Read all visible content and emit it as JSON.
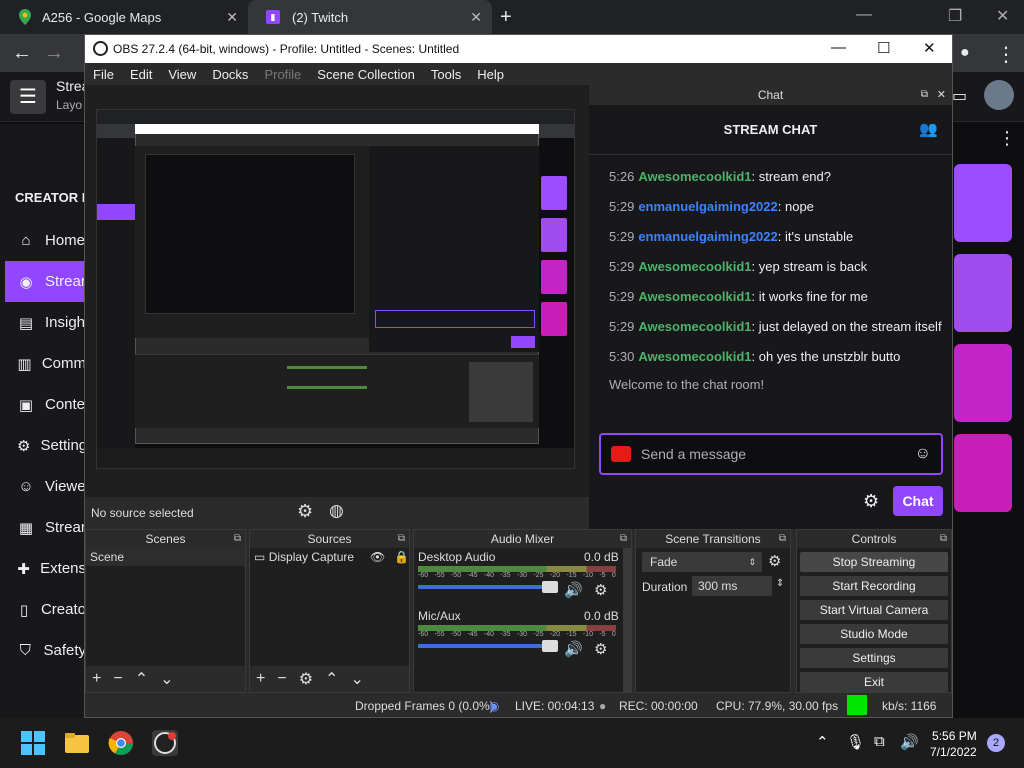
{
  "browser": {
    "tabs": [
      {
        "label": "A256 - Google Maps",
        "icon": "google-maps-icon"
      },
      {
        "label": "(2) Twitch",
        "icon": "twitch-icon"
      }
    ],
    "new_tab": "+"
  },
  "twitch": {
    "header_title": "Strea",
    "header_subtitle": "Layo",
    "creator_dashboard": "CREATOR D",
    "nav": [
      {
        "label": "Home",
        "icon": "home-icon"
      },
      {
        "label": "Strear",
        "icon": "stream-icon"
      },
      {
        "label": "Insigh",
        "icon": "insights-icon"
      },
      {
        "label": "Comm",
        "icon": "community-icon"
      },
      {
        "label": "Conte",
        "icon": "content-icon"
      },
      {
        "label": "Setting",
        "icon": "settings-icon"
      },
      {
        "label": "Viewe",
        "icon": "viewer-icon"
      },
      {
        "label": "Strear",
        "icon": "stream-tools-icon"
      },
      {
        "label": "Extens",
        "icon": "extensions-icon"
      },
      {
        "label": "Creato",
        "icon": "creator-camp-icon"
      },
      {
        "label": "Safety",
        "icon": "safety-icon"
      }
    ],
    "accent": "#9147ff"
  },
  "obs": {
    "title": "OBS 27.2.4 (64-bit, windows) - Profile: Untitled - Scenes: Untitled",
    "menu": [
      "File",
      "Edit",
      "View",
      "Docks",
      "Profile",
      "Scene Collection",
      "Tools",
      "Help"
    ],
    "source_status": "No source selected",
    "chat": {
      "dock_title": "Chat",
      "header": "STREAM CHAT",
      "messages": [
        {
          "time": "5:26",
          "user": "Awesomecoolkid1",
          "text": ": stream end?",
          "color": "#4bb36b"
        },
        {
          "time": "5:29",
          "user": "enmanuelgaiming2022",
          "text": ": nope",
          "color": "#3a83ff"
        },
        {
          "time": "5:29",
          "user": "enmanuelgaiming2022",
          "text": ": it's unstable",
          "color": "#3a83ff"
        },
        {
          "time": "5:29",
          "user": "Awesomecoolkid1",
          "text": ": yep stream is back",
          "color": "#4bb36b"
        },
        {
          "time": "5:29",
          "user": "Awesomecoolkid1",
          "text": ": it works fine for me",
          "color": "#4bb36b"
        },
        {
          "time": "5:29",
          "user": "Awesomecoolkid1",
          "text": ": just delayed on the stream itself",
          "color": "#4bb36b"
        },
        {
          "time": "5:30",
          "user": "Awesomecoolkid1",
          "text": ": oh yes the unstzblr butto",
          "color": "#4bb36b"
        }
      ],
      "welcome": "Welcome to the chat room!",
      "input_placeholder": "Send a message",
      "send_label": "Chat"
    },
    "docks": {
      "scenes": {
        "title": "Scenes",
        "items": [
          "Scene"
        ]
      },
      "sources": {
        "title": "Sources",
        "items": [
          "Display Capture"
        ]
      },
      "mixer": {
        "title": "Audio Mixer",
        "channels": [
          {
            "name": "Desktop Audio",
            "level": "0.0 dB"
          },
          {
            "name": "Mic/Aux",
            "level": "0.0 dB"
          }
        ],
        "scale": [
          "-60",
          "-55",
          "-50",
          "-45",
          "-40",
          "-35",
          "-30",
          "-25",
          "-20",
          "-15",
          "-10",
          "-5",
          "0"
        ]
      },
      "transitions": {
        "title": "Scene Transitions",
        "selected": "Fade",
        "duration_label": "Duration",
        "duration_value": "300 ms"
      },
      "controls": {
        "title": "Controls",
        "buttons": [
          "Stop Streaming",
          "Start Recording",
          "Start Virtual Camera",
          "Studio Mode",
          "Settings",
          "Exit"
        ]
      }
    },
    "status": {
      "dropped": "Dropped Frames 0 (0.0%)",
      "live": "LIVE: 00:04:13",
      "rec": "REC: 00:00:00",
      "cpu": "CPU: 77.9%, 30.00 fps",
      "kbs": "kb/s: 1166",
      "indicator_color": "#00e600"
    }
  },
  "taskbar": {
    "time": "5:56 PM",
    "date": "7/1/2022",
    "notifications": "2"
  }
}
